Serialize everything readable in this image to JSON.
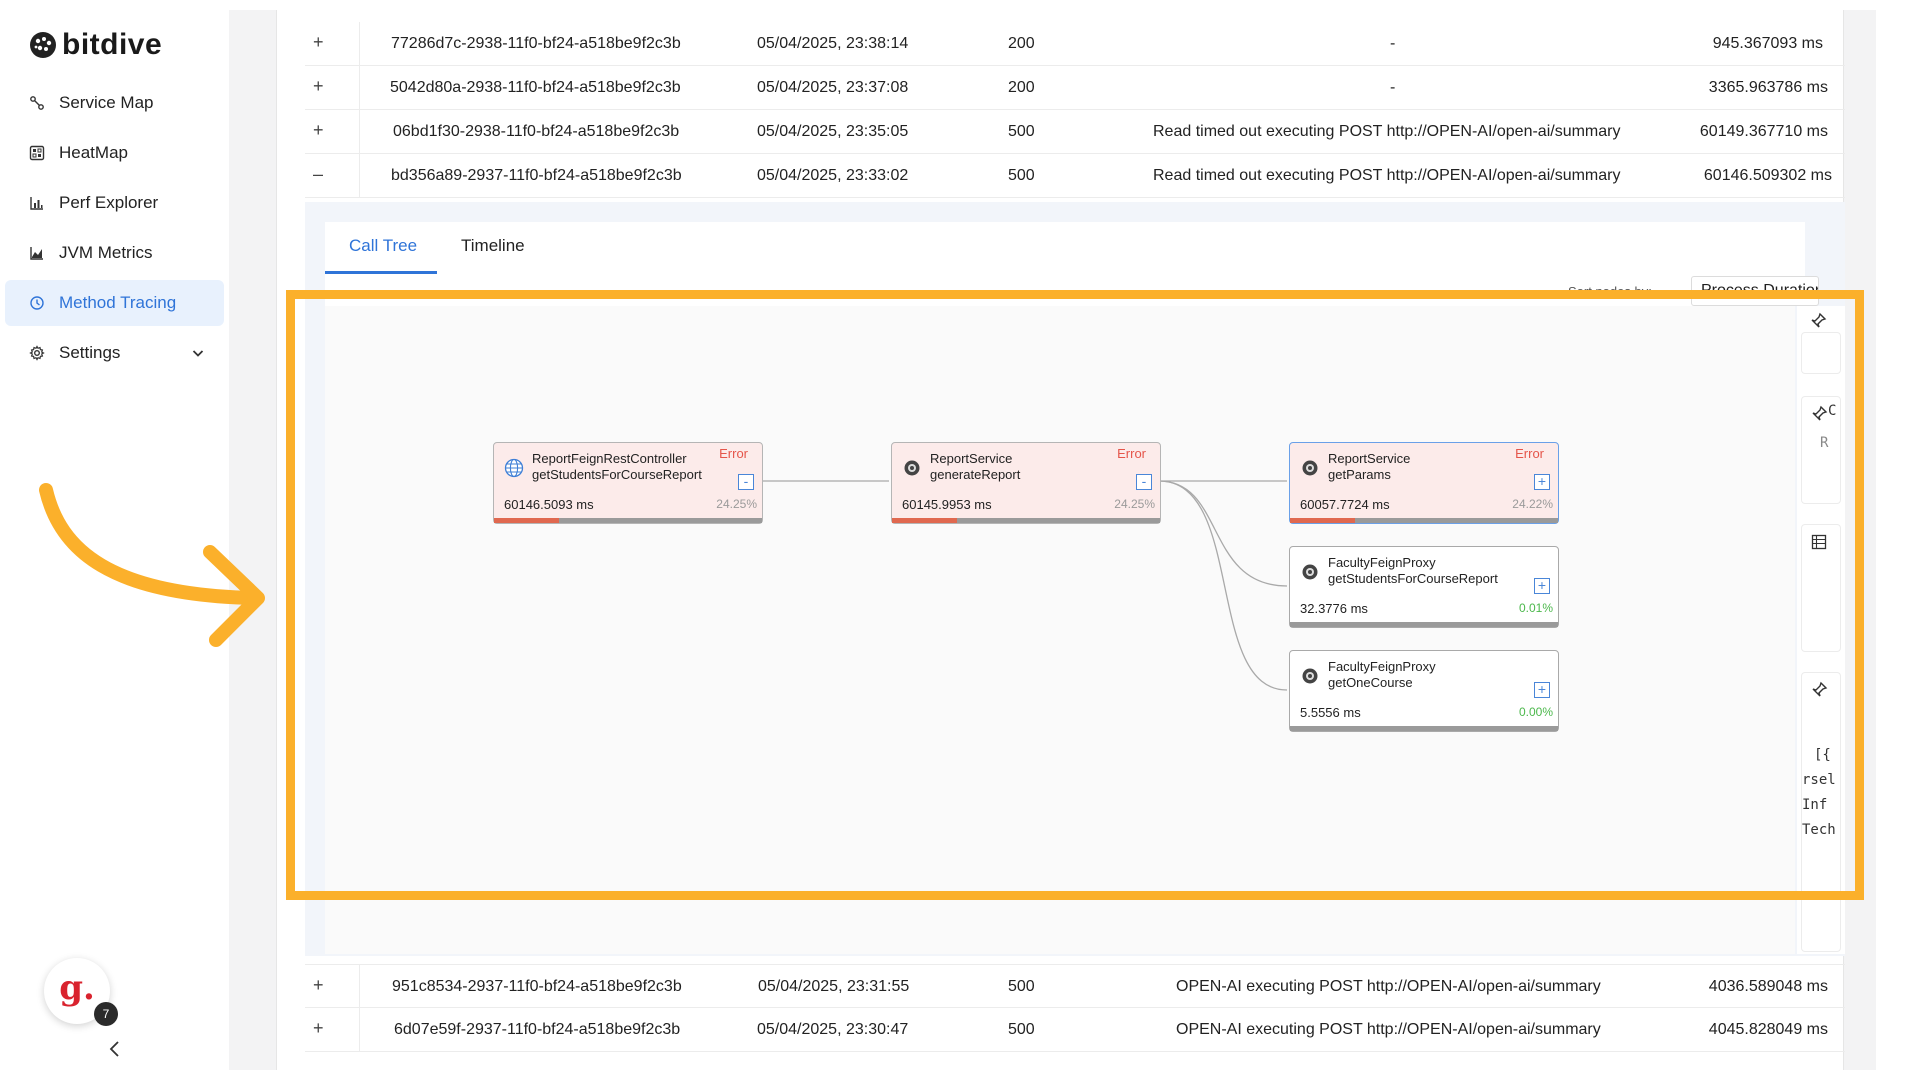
{
  "brand": {
    "name": "bitdive"
  },
  "sidebar": {
    "items": [
      {
        "label": "Service Map",
        "icon": "service-map-icon"
      },
      {
        "label": "HeatMap",
        "icon": "heatmap-icon"
      },
      {
        "label": "Perf Explorer",
        "icon": "perf-explorer-icon"
      },
      {
        "label": "JVM Metrics",
        "icon": "jvm-metrics-icon"
      },
      {
        "label": "Method Tracing",
        "icon": "method-tracing-icon",
        "active": true
      },
      {
        "label": "Settings",
        "icon": "gear-icon"
      }
    ]
  },
  "avatar": {
    "letter": "g.",
    "badge": "7"
  },
  "accent_color": "#2f74d8",
  "highlight_color": "#fbb02b",
  "table": {
    "rows_top": [
      {
        "expander": "+",
        "id": "77286d7c-2938-11f0-bf24-a518be9f2c3b",
        "time": "05/04/2025, 23:38:14",
        "status": "200",
        "error": "-",
        "duration": "945.367093 ms"
      },
      {
        "expander": "+",
        "id": "5042d80a-2938-11f0-bf24-a518be9f2c3b",
        "time": "05/04/2025, 23:37:08",
        "status": "200",
        "error": "-",
        "duration": "3365.963786 ms"
      },
      {
        "expander": "+",
        "id": "06bd1f30-2938-11f0-bf24-a518be9f2c3b",
        "time": "05/04/2025, 23:35:05",
        "status": "500",
        "error": "Read timed out executing POST http://OPEN-AI/open-ai/summary",
        "duration": "60149.367710 ms"
      },
      {
        "expander": "–",
        "id": "bd356a89-2937-11f0-bf24-a518be9f2c3b",
        "time": "05/04/2025, 23:33:02",
        "status": "500",
        "error": "Read timed out executing POST http://OPEN-AI/open-ai/summary",
        "duration": "60146.509302 ms"
      }
    ],
    "rows_bottom": [
      {
        "expander": "+",
        "id": "951c8534-2937-11f0-bf24-a518be9f2c3b",
        "time": "05/04/2025, 23:31:55",
        "status": "500",
        "error": "OPEN-AI executing POST http://OPEN-AI/open-ai/summary",
        "duration": "4036.589048 ms"
      },
      {
        "expander": "+",
        "id": "6d07e59f-2937-11f0-bf24-a518be9f2c3b",
        "time": "05/04/2025, 23:30:47",
        "status": "500",
        "error": "OPEN-AI executing POST http://OPEN-AI/open-ai/summary",
        "duration": "4045.828049 ms"
      }
    ]
  },
  "panel": {
    "tabs": [
      {
        "label": "Call Tree",
        "active": true
      },
      {
        "label": "Timeline"
      }
    ],
    "sort_label": "Sort nodes by:",
    "sort_value": "Process Duration",
    "side_text": [
      "[{",
      "rsel",
      "Inf",
      "Tech"
    ],
    "side_letters": [
      "C",
      "R"
    ]
  },
  "call_tree": {
    "nodes": [
      {
        "key": "n1",
        "icon": "globe-icon",
        "class": "ReportFeignRestController",
        "method": "getStudentsForCourseReport",
        "duration": "60146.5093  ms",
        "percent": "24.25%",
        "fill": 0.2425,
        "error": "Error",
        "toggle": "-"
      },
      {
        "key": "n2",
        "icon": "gear-icon",
        "class": "ReportService",
        "method": "generateReport",
        "duration": "60145.9953  ms",
        "percent": "24.25%",
        "fill": 0.2425,
        "error": "Error",
        "toggle": "-"
      },
      {
        "key": "n3",
        "icon": "gear-icon",
        "class": "ReportService",
        "method": "getParams",
        "duration": "60057.7724  ms",
        "percent": "24.22%",
        "fill": 0.2422,
        "error": "Error",
        "toggle": "+"
      },
      {
        "key": "n4",
        "icon": "gear-icon",
        "class": "FacultyFeignProxy",
        "method": "getStudentsForCourseReport",
        "duration": "32.3776  ms",
        "percent": "0.01%",
        "fill": 0.0001,
        "error": "",
        "toggle": "+"
      },
      {
        "key": "n5",
        "icon": "gear-icon",
        "class": "FacultyFeignProxy",
        "method": "getOneCourse",
        "duration": "5.5556  ms",
        "percent": "0.00%",
        "fill": 0.0,
        "error": "",
        "toggle": "+"
      }
    ]
  }
}
